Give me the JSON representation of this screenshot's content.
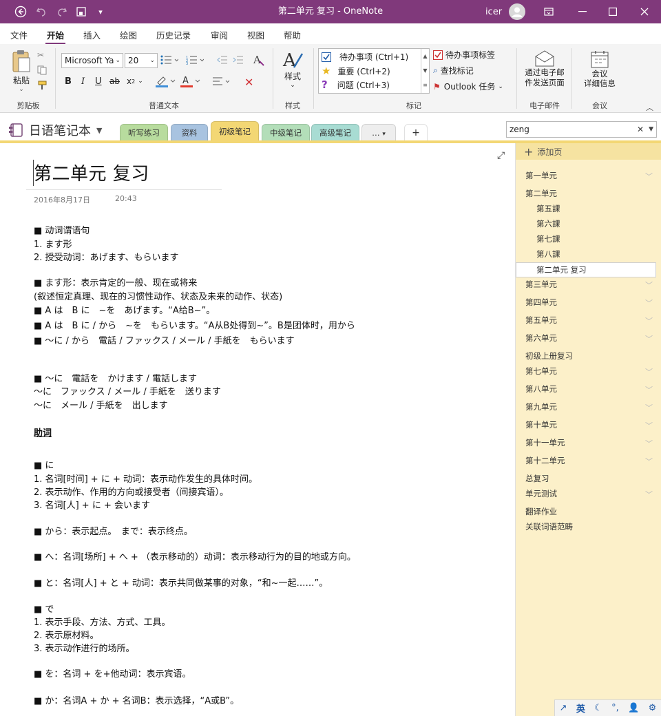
{
  "window": {
    "title": "第二单元 复习  -  OneNote",
    "user": "icer"
  },
  "menu": [
    "文件",
    "开始",
    "插入",
    "绘图",
    "历史记录",
    "审阅",
    "视图",
    "帮助"
  ],
  "ribbon": {
    "clipboard": {
      "paste": "粘贴",
      "label": "剪贴板"
    },
    "text": {
      "font": "Microsoft Ya",
      "size": "20",
      "label": "普通文本"
    },
    "styles": {
      "btn": "样式",
      "label": "样式"
    },
    "tags": {
      "items": [
        "待办事项 (Ctrl+1)",
        "重要 (Ctrl+2)",
        "问题 (Ctrl+3)"
      ],
      "todo_tag": "待办事项标签",
      "find_tags": "查找标记",
      "outlook": "Outlook 任务",
      "label": "标记"
    },
    "email": {
      "btn": [
        "通过电子邮",
        "件发送页面"
      ],
      "label": "电子邮件"
    },
    "meeting": {
      "btn": [
        "会议",
        "详细信息"
      ],
      "label": "会议"
    }
  },
  "notebook": {
    "name": "日语笔记本",
    "sections": [
      "听写练习",
      "资料",
      "初级笔记",
      "中级笔记",
      "高级笔记"
    ],
    "section_colors": [
      "#b8dc9e",
      "#a8c3e0",
      "#f3d774",
      "#b3deb9",
      "#a8dcd3"
    ],
    "active_section": 2,
    "more": "…",
    "add": "+",
    "search": "zeng"
  },
  "page": {
    "title": "第二单元 复习",
    "date": "2016年8月17日",
    "time": "20:43",
    "lines": [
      "■ 动词谓语句",
      "    1. ます形",
      "    2. 授受动词：あげます、もらいます",
      "■ ます形：表示肯定的一般、现在或将来",
      "      (叙述恒定真理、现在的习惯性动作、状态及未来的动作、状态)",
      "■ A は　B に　~を　あげます。“A给B~”。",
      "■ A は　B に / から　~を　もらいます。“A从B处得到~”。B是团体时，用から",
      "■ ～に / から　電話 / ファックス / メール / 手紙を　もらいます",
      "■ ～に　電話を　かけます / 電話します",
      "   ～に　ファックス / メール / 手紙を　送ります",
      "   ～に　メール / 手紙を　出します",
      "助词",
      "■ に",
      "1. 名词[时间] + に + 动词：表示动作发生的具体时间。",
      "2. 表示动作、作用的方向或接受者（间接宾语）。",
      "3. 名词[人] + に + 会います",
      "■ から：表示起点。　まで：表示终点。",
      "■ へ：名词[场所] + へ + （表示移动的）动词：表示移动行为的目的地或方向。",
      "■ と：名词[人] + と + 动词：表示共同做某事的对象，“和~一起……”。",
      "■ で",
      "1. 表示手段、方法、方式、工具。",
      "2. 表示原材料。",
      "3. 表示动作进行的场所。",
      "■ を：名词 + を+他动词：表示宾语。",
      "■ か：名词A + か + 名词B：表示选择，“A或B”。"
    ]
  },
  "pages_pane": {
    "add": "添加页",
    "items": [
      "第一单元",
      "第二单元",
      "第五課",
      "第六課",
      "第七課",
      "第八課",
      "第二单元 复习",
      "第三单元",
      "第四单元",
      "第五单元",
      "第六单元",
      "初级上册复习",
      "第七单元",
      "第八单元",
      "第九单元",
      "第十单元",
      "第十一单元",
      "第十二单元",
      "总复习",
      "单元测试",
      "翻译作业",
      "关联词语范畴"
    ]
  },
  "ime": {
    "lang": "英"
  }
}
